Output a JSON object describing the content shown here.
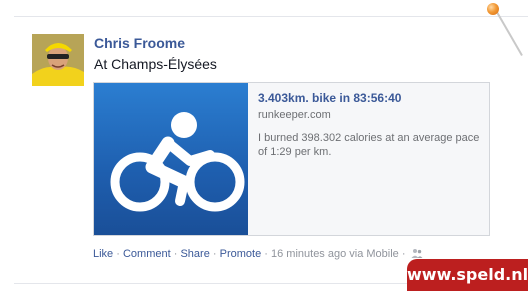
{
  "post": {
    "author_name": "Chris Froome",
    "status_text": "At Champs-Élysées",
    "attachment": {
      "title": "3.403km. bike in 83:56:40",
      "domain": "runkeeper.com",
      "description": "I burned 398.302 calories at an average pace of 1:29 per km.",
      "thumbnail_icon": "cyclist-icon"
    },
    "actions": {
      "like": "Like",
      "comment": "Comment",
      "share": "Share",
      "promote": "Promote",
      "separator": "·",
      "timestamp": "16 minutes ago",
      "via": "via Mobile",
      "audience_icon": "friends-icon"
    }
  },
  "watermark": {
    "text": "www.speld.nl"
  },
  "colors": {
    "link": "#3b5998",
    "meta": "#90949c",
    "thumb_blue": "#2b7ed1",
    "watermark_bg": "#bc1f1f",
    "pin": "#f29a36"
  }
}
